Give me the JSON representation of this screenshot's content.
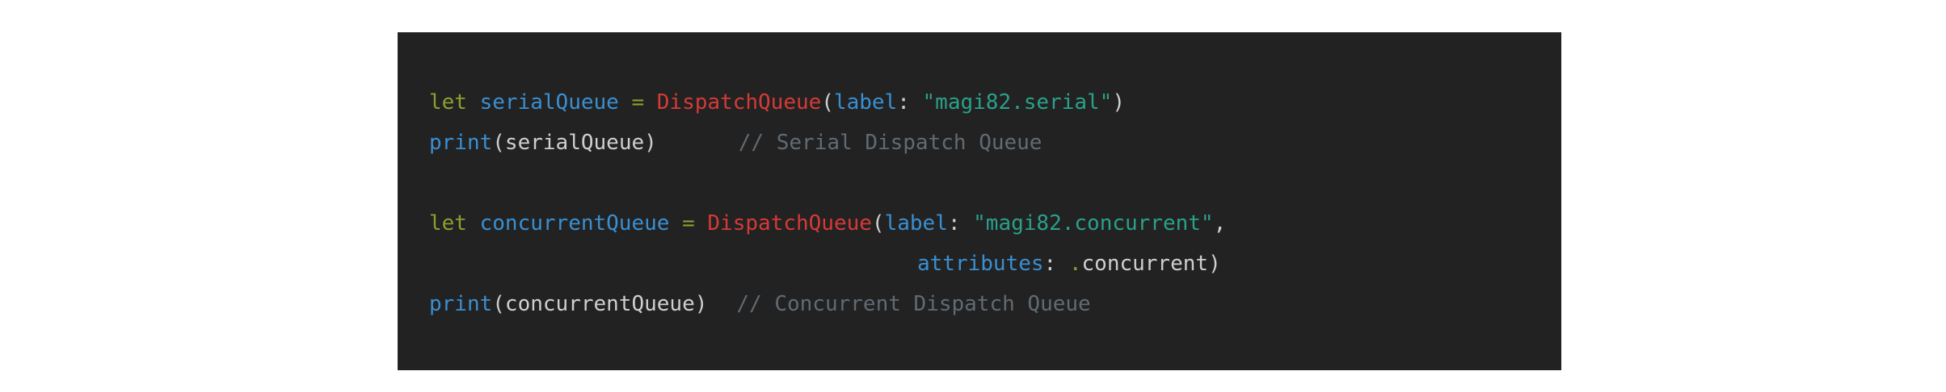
{
  "code": {
    "line1": {
      "kw": "let",
      "var": "serialQueue",
      "op": "=",
      "type": "DispatchQueue",
      "open": "(",
      "param": "label",
      "colon": ":",
      "str": "\"magi82.serial\"",
      "close": ")"
    },
    "line2": {
      "func": "print",
      "args": "(serialQueue)",
      "comment": "// Serial Dispatch Queue"
    },
    "line3": {
      "kw": "let",
      "var": "concurrentQueue",
      "op": "=",
      "type": "DispatchQueue",
      "open": "(",
      "param": "label",
      "colon": ":",
      "str": "\"magi82.concurrent\"",
      "comma": ","
    },
    "line4": {
      "param": "attributes",
      "colon": ":",
      "dot": ".",
      "value": "concurrent",
      "close": ")"
    },
    "line5": {
      "func": "print",
      "args": "(concurrentQueue)",
      "comment": "// Concurrent Dispatch Queue"
    }
  },
  "colors": {
    "background": "#222222",
    "keyword": "#8f9e2d",
    "identifier": "#3a8fd1",
    "type": "#d53a37",
    "string": "#2aa08a",
    "comment": "#5f6b75",
    "plain": "#cfcfcf"
  }
}
